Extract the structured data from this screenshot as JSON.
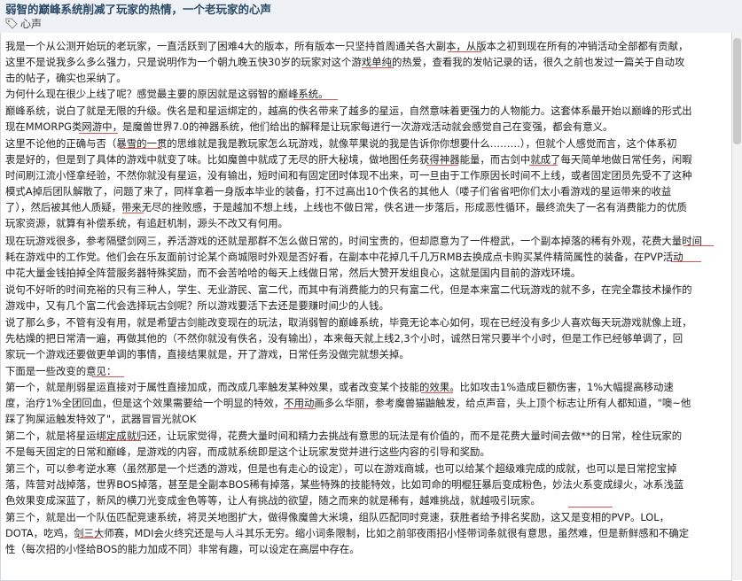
{
  "post": {
    "title": "弱智的巅峰系统削减了玩家的热情，一个老玩家的心声",
    "tag": "心声"
  },
  "paragraphs": [
    "我是一个从公测开始玩的老玩家，一直活跃到了困难4大的版本，所有版本一只坚持首周通关各大副本，从版本之初到现在所有的冲销活动全部都有贡献，\n这里不是说我多么多么强力，只是说明作为一个朝九晚五快30岁的玩家对这个游戏单纯的热爱，查看我的发帖记录的话，很久之前也发过一篇关于自动攻\n击的帖子，确实也采纳了。",
    "为何什么现在很少上线了呢？感觉最主要的原因就是这弱智的巅峰系统。",
    "巅峰系统，说白了就是无限的升级。佚名是和星运绑定的，越高的佚名带来了越多的星运，自然意味着更强力的人物能力。这套体系最开始以巅峰的形式出\n现在MMORPG类网游中，是魔兽世界7.0的神器系统，他们给出的解释是让玩家每进行一次游戏活动就会感觉自己在变强，都会有意义。",
    "这里不论他的正确与否（暴雪的一贯的思维就是我是教玩家怎么玩游戏，就像苹果说的我是告诉你你想要什么………），但就个人感觉而言，这个体系初\n衷是好的，但是到了具体的游戏中就变了味。比如魔兽中就成了无尽的肝大秘境，做地图任务获得神器能量，而古剑中就成了每天简单地做日常任务，闲暇\n时间刷江流小怪拿经验，不然你就没有星运，没有输出，短时间和有固定团时体现不出来，可一旦由于工作原因长时间不上线，或者固定团员先受不了这种\n模式A掉后团队解散了，问题了来了，同样拿着一身版本毕业的装备，打不过高出10个佚名的其他人（喽子们省省吧你们太小看游戏的星运带来的收益\n了），然后被其他人质疑，带来无尽的挫败感，于是越加不想上线，上线也不做日常，佚名进一步落后，形成恶性循环，最终流失了一名有消费能力的优质\n玩家资源，就算有补偿系统，有追赶机制，源头不改又有何用。",
    "现在玩游戏很多，参考隔壁剑网三，养活游戏的还就是那群不怎么做日常的，时间宝贵的，但却愿意为了一件橙武，一个副本掉落的稀有外观，花费大量时间\n耗在游戏中的工作党。他们会在乐友面前讨论某个商城限时外观是否好看，在副本中花掉几千几万RMB去换成点卡购买某件精简属性的装备，在PVP活动\n中花大量金钱拍掉全阵营服务器特殊奖励，而不会苦哈哈的每天上线做日常，然后大赞开发组良心，这就是国内目前的游戏环境。",
    "说句不好听的时间充裕的只有三种人，学生、无业游民、富二代，而其中有消费能力的只有富二代，但是本来富二代玩游戏的就不多，在完全靠技术操作的\n游戏中，又有几个富二代会选择玩古剑呢？所以游戏要活下去还是要赚时间少的人钱。",
    "说了那么多，不管有没有用，就是希望古剑能改变现在的玩法，取消弱智的巅峰系统，毕竟无论本心如何，现在已经没有多少人喜欢每天玩游戏就像上班，\n先枯燥的把日常清一遍，再做其他的（不然你就没有佚名，没有输出），本来每天就上线2,3个小时，诚然日常只要半个小时，但是工作已经够单调了，回\n家玩一个游戏还要做更单调的事情，直接结果就是，开了游戏，日常任务没做完就想关掉。",
    "下面是一些改变的意见：",
    "第一个，就是削弱星运直接对于属性直接加成，而改成几率触发某种效果，或者改变某个技能的效果。比如攻击1%造成巨额伤害，1%大幅提高移动速\n度，治疗1%全团回血，但是这个效果需要给一个明显的特效，不用动画多么华丽，参考魔兽猫鼬触发，给点声音，头上顶个标志让所有人都知道，\"噢~他\n踩了狗屎运触发特效了\"，武器冒冒光就OK",
    "第二个，就是将星运绑定成就归还，让玩家觉得，花费大量时间和精力去挑战有意思的玩法是有价值的，而不是花费大量时间去做**的日常，栓住玩家的\n不是每天固定的日常和巅峰，是游戏的内容，而成就系统即是这个让玩家发觉并进行这些内容的引导和奖励。",
    "第三个，可以参考逆水寒（虽然那是一个烂透的游戏，但是也有走心的设定），可以在游戏商城，也可以给某个超级难完成的成就，也可以是日常挖宝掉\n落，阵营对战掉落，世界BOS掉落，甚至是全副本BOS稀有掉落，某些特殊的技能特效，比如司命的明棍狂暴后变成粉色，妙法火系变成绿火，冰系浅蓝\n色效果变成深蓝了，新风的横刀光变成金色等等，让人有挑战的欲望，随之而来的就是稀有，越难挑战，就越吸引玩家。",
    "第三个，就是出一个队伍匹配竞速系统，将灵关地图扩大，做得像魔兽大米境，组队匹配同时竞速，获胜者给予排名奖励，这又是变相的PVP。LOL，\nDOTA，吃鸡，剑三大师赛，MDI会火终究还是与人斗其乐无穷。缩小词条限制，比如之前邬夜雨招小怪带词条就很有意思，虽然难，但是新鲜感和不确定\n性（每次招的小怪给BOS的能力加成不同）非常有趣，可以设定在高层中存在。"
  ]
}
